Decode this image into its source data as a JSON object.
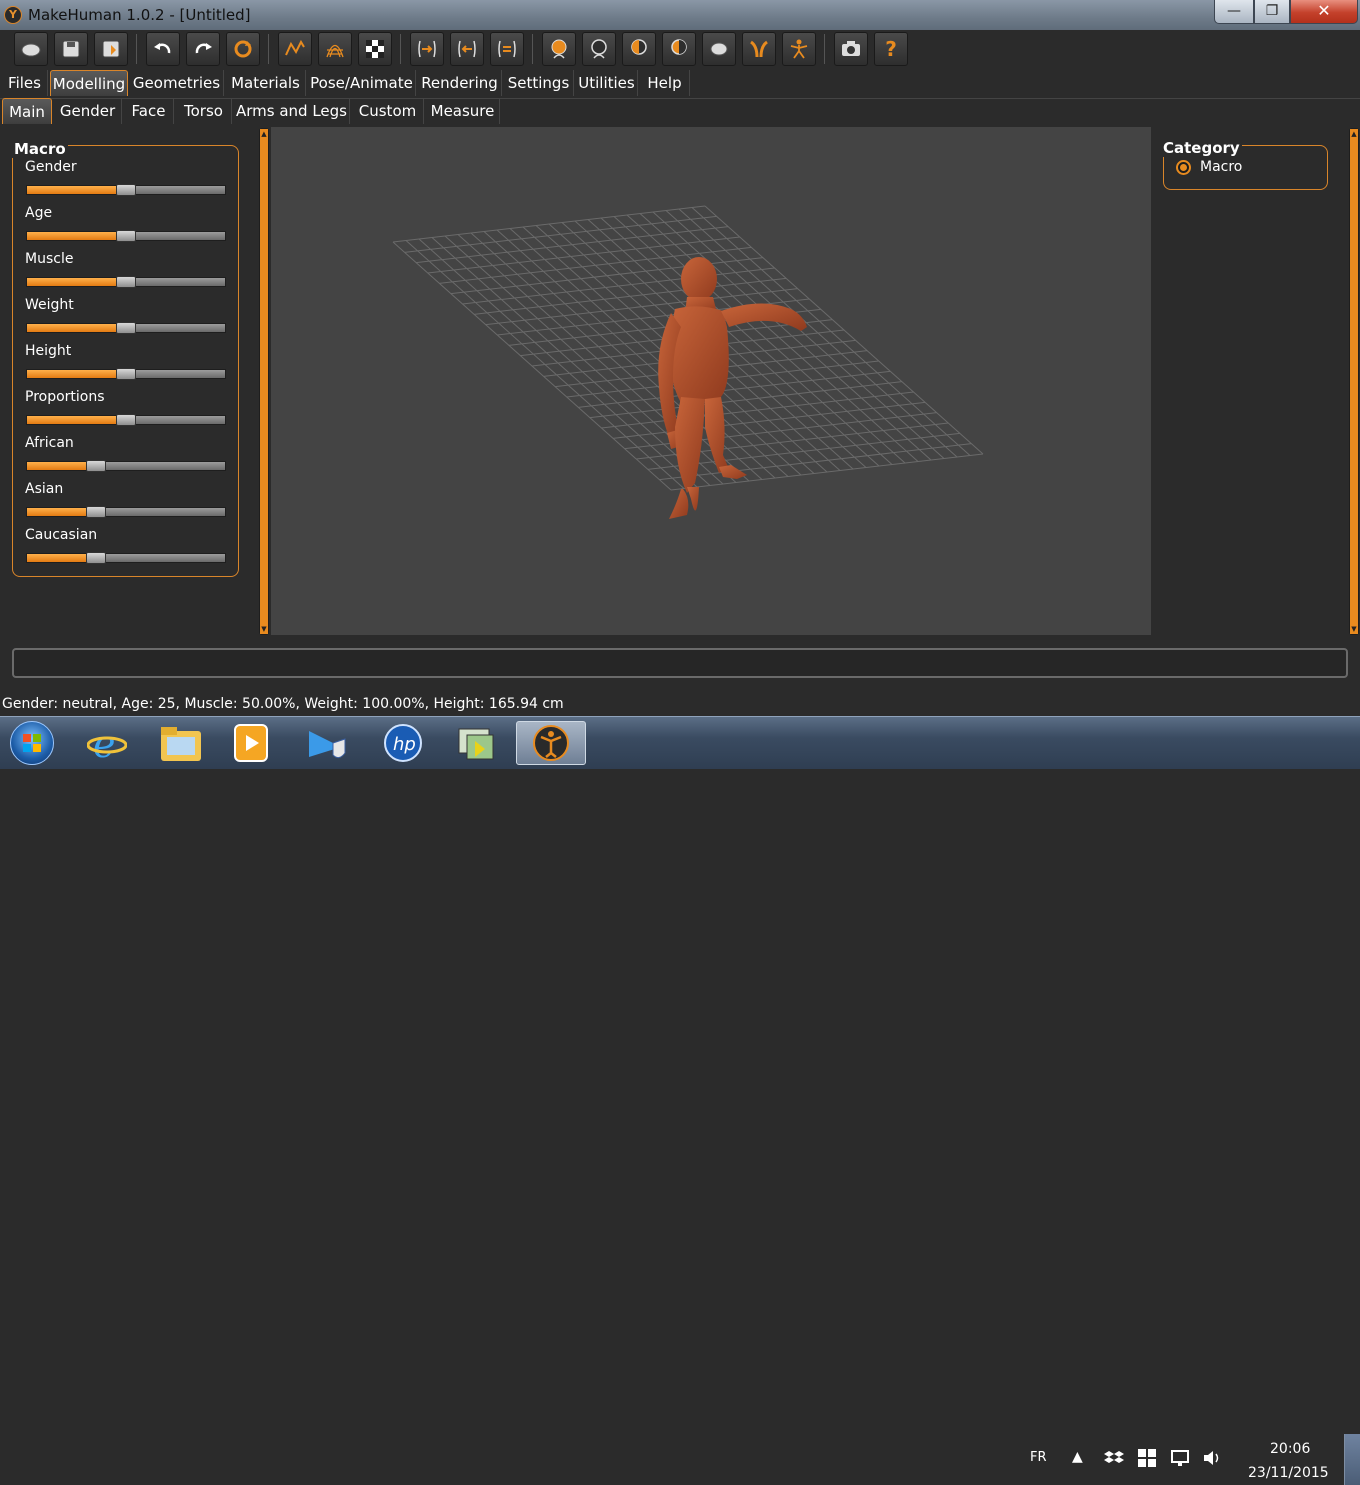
{
  "window": {
    "title": "MakeHuman 1.0.2 - [Untitled]",
    "minimize": "—",
    "maximize": "❐",
    "close": "✕"
  },
  "toolbar": {
    "buttons": [
      "load",
      "save",
      "export",
      "undo",
      "redo",
      "reset",
      "smooth",
      "wireframe",
      "background",
      "front-view",
      "back-view",
      "side-view",
      "left-view",
      "right-view",
      "top-view",
      "bottom-view",
      "reset-camera",
      "skeleton",
      "screenshot",
      "help"
    ]
  },
  "menu": {
    "tabs": [
      "Files",
      "Modelling",
      "Geometries",
      "Materials",
      "Pose/Animate",
      "Rendering",
      "Settings",
      "Utilities",
      "Help"
    ],
    "active": "Modelling"
  },
  "subtabs": {
    "tabs": [
      "Main",
      "Gender",
      "Face",
      "Torso",
      "Arms and Legs",
      "Custom",
      "Measure"
    ],
    "active": "Main"
  },
  "macro": {
    "title": "Macro",
    "sliders": [
      {
        "label": "Gender",
        "value": 0.5
      },
      {
        "label": "Age",
        "value": 0.5
      },
      {
        "label": "Muscle",
        "value": 0.5
      },
      {
        "label": "Weight",
        "value": 0.5
      },
      {
        "label": "Height",
        "value": 0.5
      },
      {
        "label": "Proportions",
        "value": 0.5
      },
      {
        "label": "African",
        "value": 0.333
      },
      {
        "label": "Asian",
        "value": 0.333
      },
      {
        "label": "Caucasian",
        "value": 0.333
      }
    ]
  },
  "category": {
    "title": "Category",
    "options": [
      {
        "label": "Macro",
        "selected": true
      }
    ]
  },
  "status": "Gender: neutral, Age: 25, Muscle: 50.00%, Weight: 100.00%, Height: 165.94 cm",
  "taskbar": {
    "apps": [
      "internet-explorer",
      "file-explorer",
      "media-player",
      "network-shield",
      "hp-support",
      "file-transfer",
      "makehuman"
    ],
    "active_app": "makehuman",
    "language": "FR",
    "time": "20:06",
    "date": "23/11/2015"
  },
  "colors": {
    "accent": "#e88b1f",
    "background": "#2b2b2b",
    "viewport": "#444444",
    "skin": "#b5532e"
  }
}
